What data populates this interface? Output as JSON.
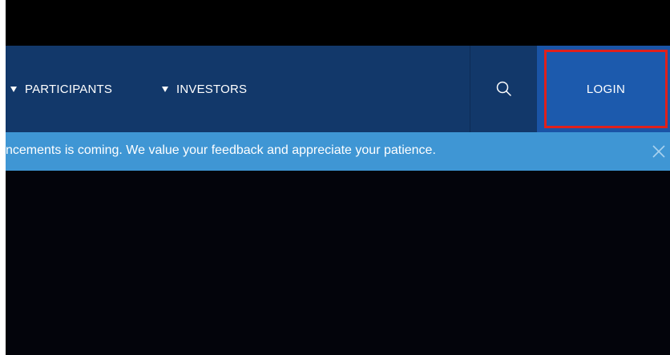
{
  "nav": {
    "items": [
      {
        "label": "PARTICIPANTS"
      },
      {
        "label": "INVESTORS"
      }
    ],
    "search_icon": "search-icon",
    "login_label": "LOGIN"
  },
  "banner": {
    "text": "ncements is coming. We value your feedback and appreciate your patience.",
    "close_icon": "close-icon"
  },
  "colors": {
    "nav_bg": "#12386a",
    "login_bg": "#1a54a6",
    "highlight_border": "#e0201c",
    "banner_bg": "#3f96d4"
  }
}
